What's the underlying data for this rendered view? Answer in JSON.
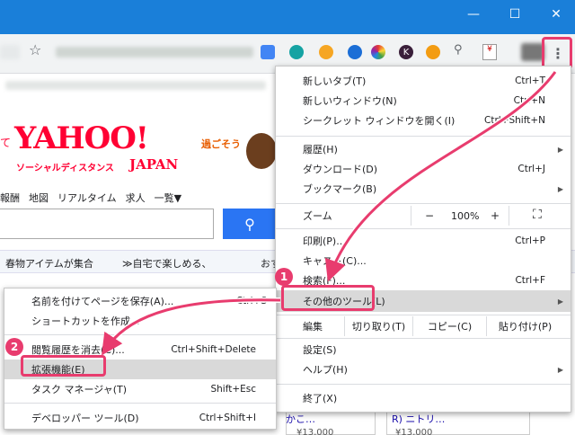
{
  "page": {
    "logo_text": "YAHOO!",
    "logo_sub_left": "ソーシャルディスタンス",
    "logo_sub_right": "JAPAN",
    "left_frag": "て",
    "right_frag": "過ごそう",
    "nav": [
      "報酬",
      "地図",
      "リアルタイム",
      "求人",
      "一覧▼"
    ],
    "banner": [
      "春物アイテムが集合",
      "≫自宅で楽しめる、",
      "おすすめ"
    ],
    "bottom_frag1": "かこ…",
    "bottom_frag2": "R) ニトリ…",
    "price1": "¥13,000",
    "price2": "¥13,000"
  },
  "chrome_menu": {
    "items": [
      {
        "label": "新しいタブ(T)",
        "shortcut": "Ctrl+T"
      },
      {
        "label": "新しいウィンドウ(N)",
        "shortcut": "Ctrl+N"
      },
      {
        "label": "シークレット ウィンドウを開く(I)",
        "shortcut": "Ctrl+Shift+N"
      },
      {
        "label": "履歴(H)",
        "shortcut": ""
      },
      {
        "label": "ダウンロード(D)",
        "shortcut": "Ctrl+J"
      },
      {
        "label": "ブックマーク(B)",
        "shortcut": ""
      },
      {
        "label": "印刷(P)...",
        "shortcut": "Ctrl+P"
      },
      {
        "label": "キャスト(C)...",
        "shortcut": ""
      },
      {
        "label": "検索(F)...",
        "shortcut": "Ctrl+F"
      },
      {
        "label": "その他のツール(L)",
        "shortcut": ""
      },
      {
        "label": "設定(S)",
        "shortcut": ""
      },
      {
        "label": "ヘルプ(H)",
        "shortcut": ""
      },
      {
        "label": "終了(X)",
        "shortcut": ""
      }
    ],
    "zoom": {
      "label": "ズーム",
      "minus": "−",
      "value": "100%",
      "plus": "+",
      "fullscreen": "⛶"
    },
    "edit": {
      "label": "編集",
      "cut": "切り取り(T)",
      "copy": "コピー(C)",
      "paste": "貼り付け(P)"
    }
  },
  "submenu": {
    "items": [
      {
        "label": "名前を付けてページを保存(A)...",
        "shortcut": "Ctrl+S"
      },
      {
        "label": "ショートカットを作成...",
        "shortcut": ""
      },
      {
        "label": "閲覧履歴を消去(C)...",
        "shortcut": "Ctrl+Shift+Delete"
      },
      {
        "label": "拡張機能(E)",
        "shortcut": ""
      },
      {
        "label": "タスク マネージャ(T)",
        "shortcut": "Shift+Esc"
      },
      {
        "label": "デベロッパー ツール(D)",
        "shortcut": "Ctrl+Shift+I"
      }
    ]
  },
  "badges": {
    "one": "1",
    "two": "2"
  },
  "colors": {
    "accent": "#e83c6e",
    "titlebar": "#1a7fd9",
    "yahoo_red": "#ff0033",
    "search_blue": "#2a75f3"
  }
}
